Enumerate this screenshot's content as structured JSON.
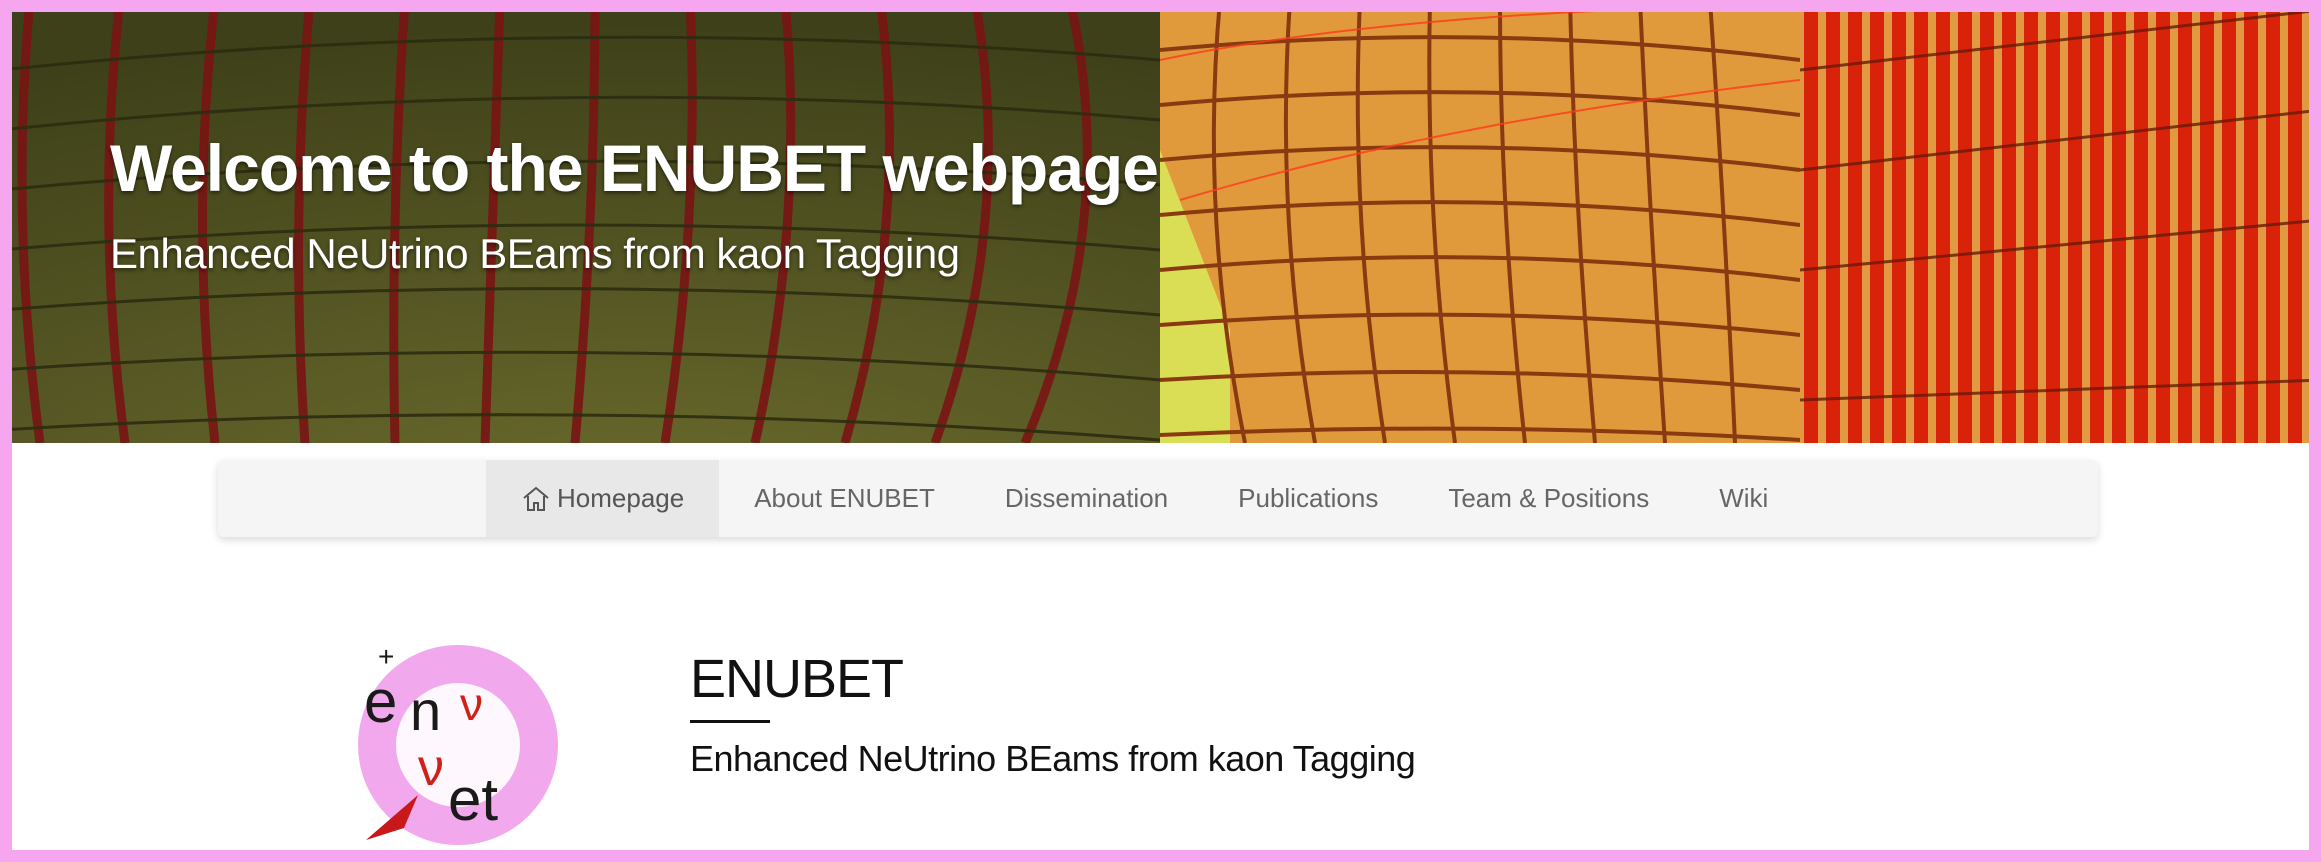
{
  "hero": {
    "title": "Welcome to the ENUBET webpage",
    "subtitle": "Enhanced NeUtrino BEams from kaon Tagging"
  },
  "nav": {
    "items": [
      {
        "label": "Homepage",
        "icon": "home-icon",
        "active": true
      },
      {
        "label": "About ENUBET"
      },
      {
        "label": "Dissemination"
      },
      {
        "label": "Publications"
      },
      {
        "label": "Team & Positions"
      },
      {
        "label": "Wiki"
      }
    ]
  },
  "main": {
    "title": "ENUBET",
    "subtitle": "Enhanced NeUtrino BEams from kaon Tagging",
    "logo_text": "enubet"
  },
  "colors": {
    "frame": "#f6a6ef",
    "hero_left": "#5a5c24",
    "hero_right_tile": "#e09a3c",
    "hero_stripes": "#d42a0c",
    "logo_ring": "#f2a8ec"
  }
}
